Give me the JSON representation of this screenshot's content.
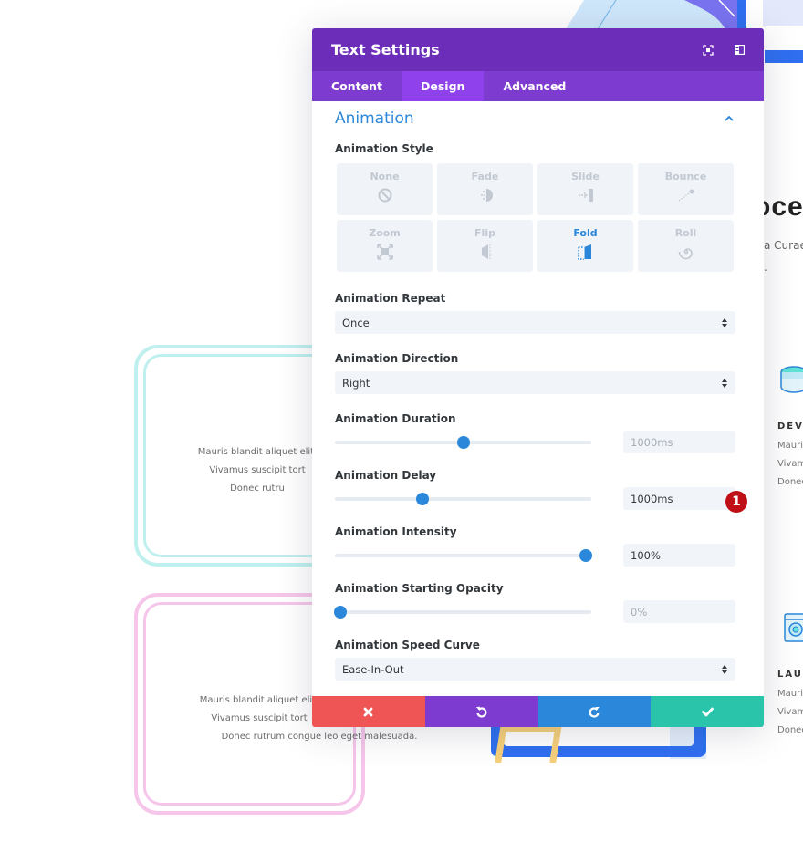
{
  "background": {
    "heading_fragment": "oces",
    "subtext_fragment": "a Curae",
    "dot": ".",
    "features": [
      {
        "title": "DEVE",
        "lines": [
          "Mauri",
          "Vivam",
          "Donec"
        ]
      },
      {
        "title": "LAUN",
        "lines": [
          "Mauri",
          "Vivam",
          "Donec"
        ]
      }
    ],
    "card_teal_lines": [
      "Mauris blandit aliquet elit,",
      "Vivamus suscipit tort",
      "Donec rutru"
    ],
    "card_pink_lines": [
      "Mauris blandit aliquet elit,",
      "Vivamus suscipit tort",
      "Donec rutrum congue leo eget malesuada."
    ]
  },
  "modal": {
    "title": "Text Settings",
    "header_icons": [
      "focus-icon",
      "split-view-icon"
    ],
    "tabs": [
      {
        "label": "Content",
        "active": false
      },
      {
        "label": "Design",
        "active": true
      },
      {
        "label": "Advanced",
        "active": false
      }
    ],
    "section": {
      "title": "Animation",
      "expanded": true
    },
    "animation_style": {
      "label": "Animation Style",
      "options": [
        {
          "label": "None",
          "icon": "none-icon",
          "active": false
        },
        {
          "label": "Fade",
          "icon": "fade-icon",
          "active": false
        },
        {
          "label": "Slide",
          "icon": "slide-icon",
          "active": false
        },
        {
          "label": "Bounce",
          "icon": "bounce-icon",
          "active": false
        },
        {
          "label": "Zoom",
          "icon": "zoom-icon",
          "active": false
        },
        {
          "label": "Flip",
          "icon": "flip-icon",
          "active": false
        },
        {
          "label": "Fold",
          "icon": "fold-icon",
          "active": true
        },
        {
          "label": "Roll",
          "icon": "roll-icon",
          "active": false
        }
      ]
    },
    "animation_repeat": {
      "label": "Animation Repeat",
      "value": "Once"
    },
    "animation_direction": {
      "label": "Animation Direction",
      "value": "Right"
    },
    "animation_duration": {
      "label": "Animation Duration",
      "value": "1000ms",
      "slider_fraction": 0.5,
      "muted": true
    },
    "animation_delay": {
      "label": "Animation Delay",
      "value": "1000ms",
      "slider_fraction": 0.34,
      "muted": false,
      "badge": "1"
    },
    "animation_intensity": {
      "label": "Animation Intensity",
      "value": "100%",
      "slider_fraction": 0.98,
      "muted": false
    },
    "animation_starting_opacity": {
      "label": "Animation Starting Opacity",
      "value": "0%",
      "slider_fraction": 0.02,
      "muted": true
    },
    "animation_speed_curve": {
      "label": "Animation Speed Curve",
      "value": "Ease-In-Out"
    },
    "footer": {
      "buttons": [
        {
          "name": "cancel",
          "icon": "close-icon",
          "color": "#ef5555"
        },
        {
          "name": "undo",
          "icon": "undo-icon",
          "color": "#7e3bd0"
        },
        {
          "name": "redo",
          "icon": "redo-icon",
          "color": "#2b87da"
        },
        {
          "name": "save",
          "icon": "check-icon",
          "color": "#29c4a9"
        }
      ]
    }
  },
  "colors": {
    "header": "#6c2eb9",
    "tabs": "#7d3bcf",
    "tab_active": "#8f42ec",
    "accent": "#2b87da",
    "badge": "#c00f16"
  }
}
